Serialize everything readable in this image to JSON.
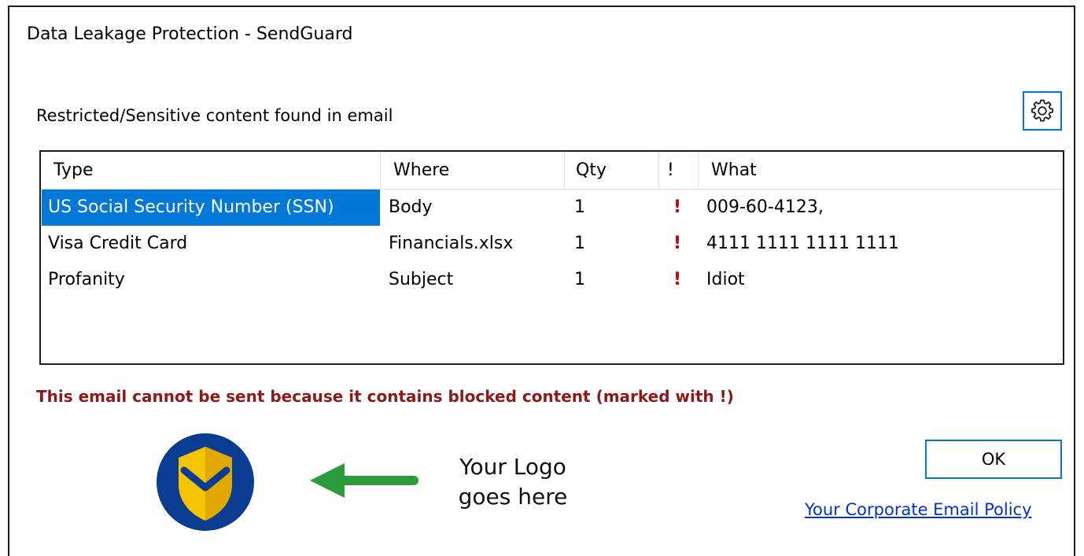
{
  "window": {
    "title": "Data Leakage Protection - SendGuard"
  },
  "header": {
    "subtitle": "Restricted/Sensitive content found in email",
    "settings_icon": "gear-icon"
  },
  "grid": {
    "columns": [
      "Type",
      "Where",
      "Qty",
      "!",
      "What"
    ],
    "rows": [
      {
        "type": "US Social Security Number (SSN)",
        "where": "Body",
        "qty": "1",
        "flag": "!",
        "what": "009-60-4123,",
        "selected": true
      },
      {
        "type": "Visa Credit Card",
        "where": "Financials.xlsx",
        "qty": "1",
        "flag": "!",
        "what": "4111 1111 1111 1111",
        "selected": false
      },
      {
        "type": "Profanity",
        "where": "Subject",
        "qty": "1",
        "flag": "!",
        "what": "Idiot",
        "selected": false
      }
    ]
  },
  "footer": {
    "warning": "This email cannot be sent because it contains blocked content (marked with !)",
    "logo_placeholder_line1": "Your Logo",
    "logo_placeholder_line2": "goes here",
    "ok_label": "OK",
    "policy_link": "Your Corporate Email Policy"
  },
  "colors": {
    "accent": "#0078d7",
    "warning_text": "#8b1a1a",
    "flag": "#cc0000",
    "logo_blue": "#0a3d91",
    "logo_gold": "#f5c400",
    "arrow_green": "#2e9b3a",
    "link": "#0033cc"
  }
}
